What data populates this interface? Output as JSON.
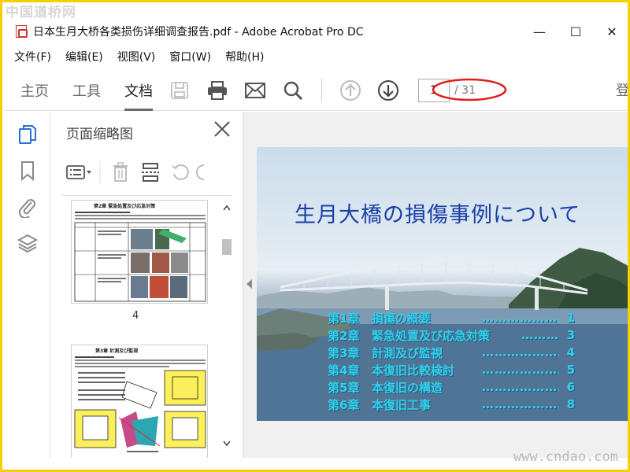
{
  "watermark": {
    "top": "中国道桥网",
    "bottom": "www.cndao.com"
  },
  "window": {
    "title": "日本生月大桥各类损伤详细调查报告.pdf - Adobe Acrobat Pro DC",
    "minimize": "—",
    "maximize": "☐",
    "close": "✕"
  },
  "menu": [
    "文件(F)",
    "编辑(E)",
    "视图(V)",
    "窗口(W)",
    "帮助(H)"
  ],
  "toolbar": {
    "tabs": [
      "主页",
      "工具",
      "文档"
    ],
    "active_tab": "文档",
    "current_page": "1",
    "total_pages": "/ 31",
    "login": "登",
    "icons": [
      "save-icon",
      "print-icon",
      "mail-icon",
      "search-icon",
      "page-up-icon",
      "page-down-icon"
    ]
  },
  "rail": {
    "icons": [
      "pages-icon",
      "bookmark-icon",
      "attachment-icon",
      "layers-icon"
    ]
  },
  "thumbnails": {
    "title": "页面缩略图",
    "pages": [
      {
        "label": "4",
        "heading": "第2章 緊急処置及び応急対策"
      },
      {
        "label": "",
        "heading": "第3章 計測及び監視"
      }
    ]
  },
  "document": {
    "slide_title": "生月大橋の損傷事例について",
    "toc": [
      {
        "chapter": "第1章",
        "name": "損傷の概要",
        "dots": "…………………",
        "page": "1"
      },
      {
        "chapter": "第2章",
        "name": "緊急処置及び応急対策",
        "dots": "………",
        "page": "3"
      },
      {
        "chapter": "第3章",
        "name": "計測及び監視",
        "dots": "…………………",
        "page": "4"
      },
      {
        "chapter": "第4章",
        "name": "本復旧比較検討",
        "dots": "…………………",
        "page": "5"
      },
      {
        "chapter": "第5章",
        "name": "本復旧の構造",
        "dots": "…………………",
        "page": "6"
      },
      {
        "chapter": "第6章",
        "name": "本復旧工事",
        "dots": "…………………",
        "page": "8"
      }
    ]
  },
  "colors": {
    "slide_title": "#1a3fa6",
    "toc_text": "#35d0e8",
    "active_icon": "#2a6fd6",
    "annotation_circle": "#e0201b",
    "frame": "#f5d000"
  }
}
